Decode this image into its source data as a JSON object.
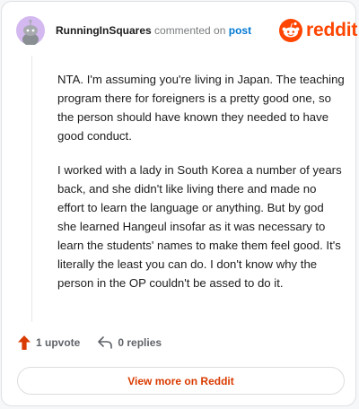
{
  "header": {
    "username": "RunningInSquares",
    "action_text": "commented on",
    "post_link": "post",
    "logo_text": "reddit",
    "avatar_icon": "snoo-avatar-icon",
    "brand_color": "#ff4500"
  },
  "comment": {
    "paragraphs": [
      "NTA. I'm assuming you're living in Japan. The teaching program there for foreigners is a pretty good one, so the person should have known they needed to have good conduct.",
      "I worked with a lady in South Korea a number of years back, and she didn't like living there and made no effort to learn the language or anything. But by god she learned Hangeul insofar as it was necessary to learn the students' names to make them feel good. It's literally the least you can do. I don't know why the person in the OP couldn't be assed to do it."
    ]
  },
  "actions": {
    "upvote_label": "1 upvote",
    "upvote_icon": "upvote-arrow-icon",
    "reply_label": "0 replies",
    "reply_icon": "reply-arrow-icon"
  },
  "footer": {
    "view_more_label": "View more on Reddit"
  }
}
